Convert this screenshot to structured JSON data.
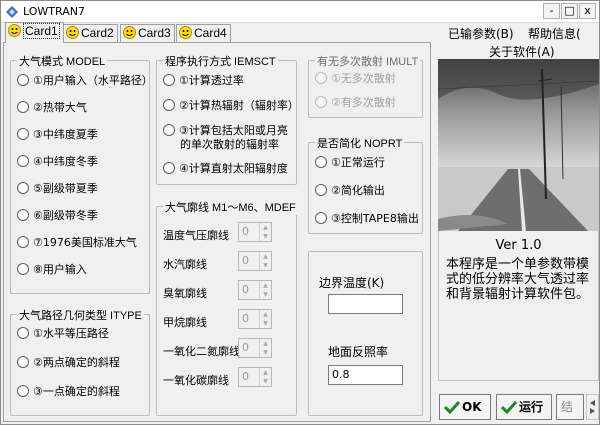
{
  "window": {
    "title": "LOWTRAN7",
    "minimize": "-",
    "maximize": "□",
    "close": "x"
  },
  "tabs": [
    "Card1",
    "Card2",
    "Card3",
    "Card4"
  ],
  "right_tabs": {
    "loaded_params": "已输参数(B)",
    "help": "帮助信息(",
    "about": "关于软件(A)"
  },
  "atm_model": {
    "title": "大气模式 MODEL",
    "options": [
      "①用户输入（水平路径）",
      "②热带大气",
      "③中纬度夏季",
      "④中纬度冬季",
      "⑤副级带夏季",
      "⑥副级带冬季",
      "⑦1976美国标准大气",
      "⑧用户输入"
    ]
  },
  "path_type": {
    "title": "大气路径几何类型 ITYPE",
    "options": [
      "①水平等压路径",
      "②两点确定的斜程",
      "③一点确定的斜程"
    ]
  },
  "exec_mode": {
    "title": "程序执行方式 IEMSCT",
    "options": [
      {
        "l1": "①计算透过率",
        "l2": ""
      },
      {
        "l1": "②计算热辐射（辐射率）",
        "l2": ""
      },
      {
        "l1": "③计算包括太阳或月亮",
        "l2": "的单次散射的辐射率"
      },
      {
        "l1": "④计算直射太阳辐射度",
        "l2": ""
      }
    ]
  },
  "profiles": {
    "title": "大气廓线 M1～M6、MDEF",
    "items": [
      {
        "label": "温度气压廓线",
        "value": "0"
      },
      {
        "label": "水汽廓线",
        "value": "0"
      },
      {
        "label": "臭氧廓线",
        "value": "0"
      },
      {
        "label": "甲烷廓线",
        "value": "0"
      },
      {
        "label": "一氧化二氮廓线",
        "value": "0"
      },
      {
        "label": "一氧化碳廓线",
        "value": "0"
      }
    ]
  },
  "multiscatter": {
    "title": "有无多次散射 IMULT",
    "options": [
      "①无多次散射",
      "②有多次散射"
    ]
  },
  "simplify": {
    "title": "是否简化 NOPRT",
    "options": [
      "①正常运行",
      "②简化输出",
      "③控制TAPE8输出"
    ]
  },
  "boundary": {
    "temp_label": "边界温度(K)",
    "temp_value": "",
    "albedo_label": "地面反照率",
    "albedo_value": "0.8"
  },
  "about": {
    "version": "Ver 1.0",
    "description": "本程序是一个单参数带模式的低分辨率大气透过率和背景辐射计算软件包。"
  },
  "buttons": {
    "ok": "OK",
    "run": "运行",
    "next": "结"
  }
}
